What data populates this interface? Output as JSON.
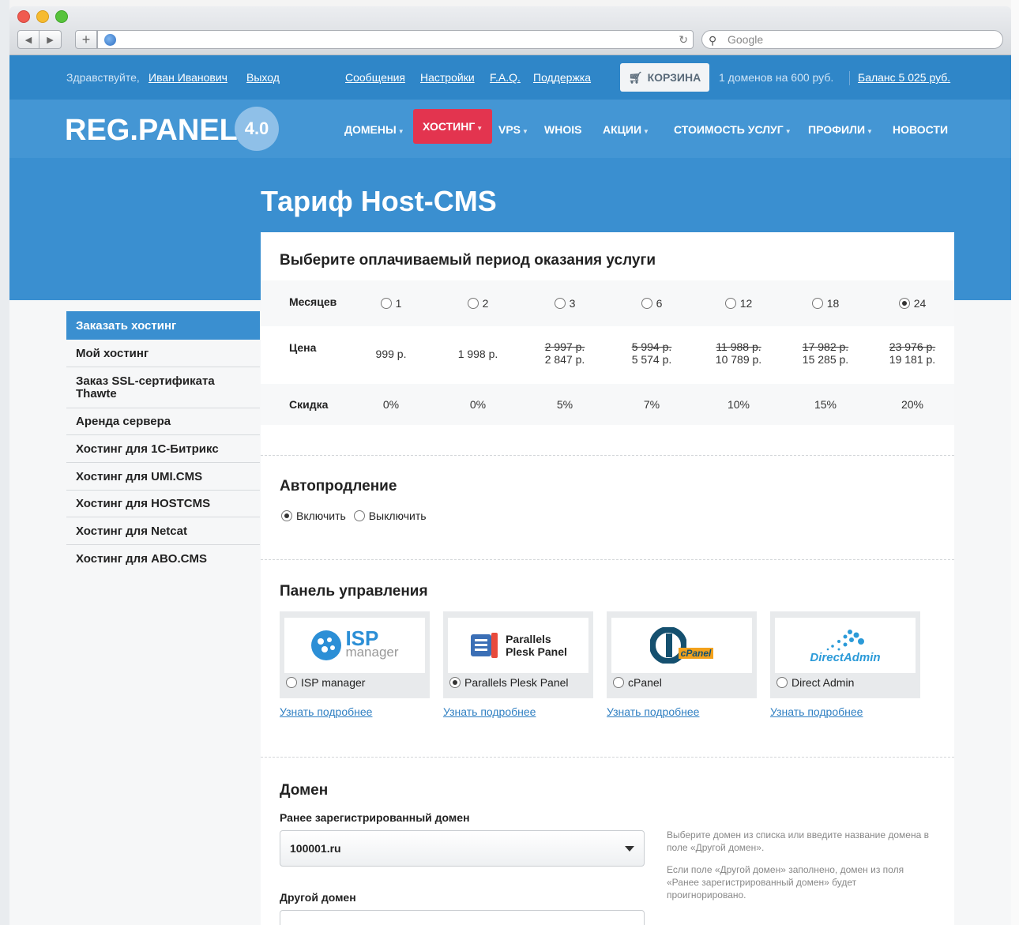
{
  "browser": {
    "search_placeholder": "Google"
  },
  "topbar": {
    "greeting": "Здравствуйте,",
    "user_name": "Иван Иванович",
    "logout": "Выход",
    "links": [
      "Сообщения",
      "Настройки",
      "F.A.Q.",
      "Поддержка"
    ],
    "cart_label": "КОРЗИНА",
    "cart_summary": "1 доменов на 600 руб.",
    "balance": "Баланс 5 025 руб."
  },
  "brand": {
    "logo": "REG.PANEL",
    "version": "4.0"
  },
  "menu": [
    {
      "label": "ДОМЕНЫ",
      "dropdown": true
    },
    {
      "label": "ХОСТИНГ",
      "dropdown": true,
      "active": true
    },
    {
      "label": "VPS",
      "dropdown": true
    },
    {
      "label": "WHOIS",
      "dropdown": false
    },
    {
      "label": "АКЦИИ",
      "dropdown": true
    },
    {
      "label": "СТОИМОСТЬ УСЛУГ",
      "dropdown": true
    },
    {
      "label": "ПРОФИЛИ",
      "dropdown": true
    },
    {
      "label": "НОВОСТИ",
      "dropdown": false
    }
  ],
  "page_title": "Тариф Host-CMS",
  "sidebar": {
    "items": [
      {
        "label": "Заказать хостинг",
        "active": true
      },
      {
        "label": "Мой хостинг"
      },
      {
        "label": "Заказ SSL-сертификата Thawte"
      },
      {
        "label": "Аренда сервера"
      },
      {
        "label": "Хостинг для 1С-Битрикс"
      },
      {
        "label": "Хостинг для UMI.CMS"
      },
      {
        "label": "Хостинг для HOSTCMS"
      },
      {
        "label": "Хостинг для Netcat"
      },
      {
        "label": "Хостинг для ABO.CMS"
      }
    ]
  },
  "period": {
    "title": "Выберите оплачиваемый период оказания услуги",
    "months_label": "Месяцев",
    "price_label": "Цена",
    "discount_label": "Скидка",
    "options": [
      {
        "months": "1",
        "old_price": "",
        "price": "999 р.",
        "discount": "0%",
        "selected": false
      },
      {
        "months": "2",
        "old_price": "",
        "price": "1 998 р.",
        "discount": "0%",
        "selected": false
      },
      {
        "months": "3",
        "old_price": "2 997 р.",
        "price": "2 847 р.",
        "discount": "5%",
        "selected": false
      },
      {
        "months": "6",
        "old_price": "5 994 р.",
        "price": "5 574 р.",
        "discount": "7%",
        "selected": false
      },
      {
        "months": "12",
        "old_price": "11 988 р.",
        "price": "10 789 р.",
        "discount": "10%",
        "selected": false
      },
      {
        "months": "18",
        "old_price": "17 982 р.",
        "price": "15 285 р.",
        "discount": "15%",
        "selected": false
      },
      {
        "months": "24",
        "old_price": "23 976 р.",
        "price": "19 181 р.",
        "discount": "20%",
        "selected": true
      }
    ]
  },
  "autorenew": {
    "title": "Автопродление",
    "on_label": "Включить",
    "off_label": "Выключить",
    "value": "on"
  },
  "control_panel": {
    "title": "Панель управления",
    "more_label": "Узнать подробнее",
    "options": [
      {
        "label": "ISP manager",
        "logo_main": "ISP",
        "logo_sub": "manager",
        "selected": false
      },
      {
        "label": "Parallels Plesk Panel",
        "logo_main": "Parallels",
        "logo_sub": "Plesk Panel",
        "selected": true
      },
      {
        "label": "cPanel",
        "logo_main": "cPanel",
        "logo_sub": "",
        "selected": false
      },
      {
        "label": "Direct Admin",
        "logo_main": "DirectAdmin",
        "logo_sub": "",
        "selected": false
      }
    ]
  },
  "domain": {
    "title": "Домен",
    "registered_label": "Ранее зарегистрированный домен",
    "registered_value": "100001.ru",
    "other_label": "Другой домен",
    "other_value": "",
    "hint1": "Выберите домен из списка или введите название домена в поле «Другой домен».",
    "hint2": "Если поле «Другой домен» заполнено, домен из поля «Ранее зарегистрированный домен» будет проигнорировано."
  },
  "colors": {
    "header_blue": "#2f86c8",
    "nav_blue": "#4496d4",
    "accent_red": "#e3344f",
    "link_blue": "#2f7fc2"
  }
}
